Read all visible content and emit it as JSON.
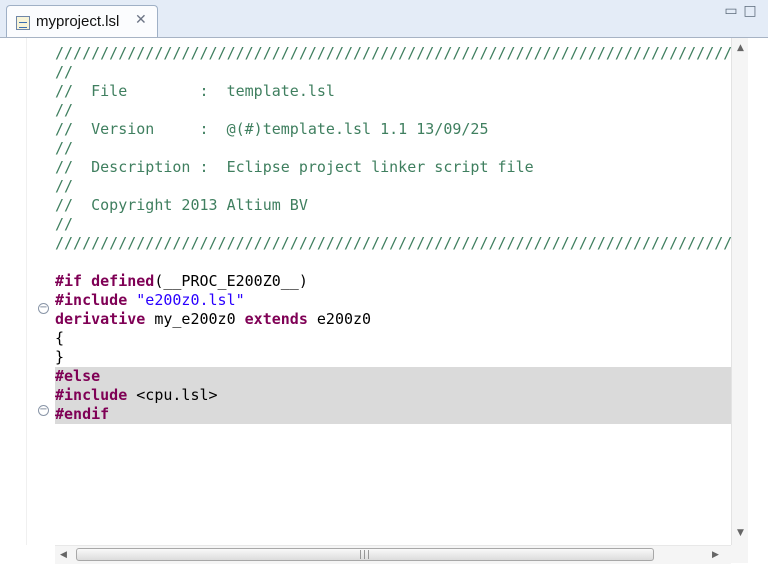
{
  "tab": {
    "icon": "linker-script-file-icon",
    "label": "myproject.lsl",
    "close_glyph": "✕",
    "close_icon": "close-icon"
  },
  "window_controls": {
    "minimize_glyph": "▭",
    "maximize_glyph": "□",
    "minimize_icon": "minimize-icon",
    "maximize_icon": "maximize-icon"
  },
  "code": {
    "comment_rule": "////////////////////////////////////////////////////////////////////////////////",
    "comment_prefix": "//",
    "file_line": "//  File        :  template.lsl",
    "version_line": "//  Version     :  @(#)template.lsl 1.1 13/09/25",
    "description_line": "//  Description :  Eclipse project linker script file",
    "copyright_line": "//  Copyright 2013 Altium BV",
    "if_kw": "#if",
    "if_defined": "defined",
    "if_arg": "(__PROC_E200Z0__)",
    "include1_kw": "#include",
    "include1_str": "\"e200z0.lsl\"",
    "derivative_kw": "derivative",
    "derivative_name": " my_e200z0 ",
    "extends_kw": "extends",
    "derivative_base": " e200z0",
    "open_brace": "{",
    "close_brace": "}",
    "else_kw": "#else",
    "include2_kw": "#include",
    "include2_arg": " <cpu.lsl>",
    "endif_kw": "#endif"
  },
  "scrollbar": {
    "up_glyph": "▲",
    "down_glyph": "▼",
    "left_glyph": "◀",
    "right_glyph": "▶",
    "grip_glyph": "|||"
  },
  "colors": {
    "comment": "#3f7f5f",
    "keyword": "#7f0055",
    "string": "#2a00ff",
    "inactive_highlight": "#dadada",
    "tab_bar": "#e4ecf7"
  }
}
